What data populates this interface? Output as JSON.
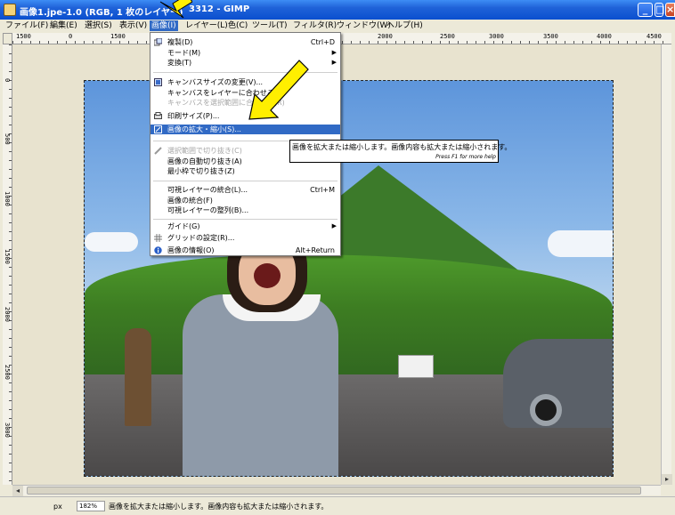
{
  "window": {
    "title_left": "画像1.jpe-1.0 (RGB, 1 枚のレイヤー)",
    "title_right": "3312 - GIMP"
  },
  "menubar": {
    "items": [
      "ファイル(F)",
      "編集(E)",
      "選択(S)",
      "表示(V)",
      "画像(I)",
      "レイヤー(L)",
      "色(C)",
      "ツール(T)",
      "フィルタ(R)",
      "ウィンドウ(W)",
      "ヘルプ(H)"
    ],
    "active_index": 4
  },
  "rulers": {
    "h_labels": [
      "1500",
      "0",
      "1500",
      "2000",
      "2500",
      "3000",
      "3500",
      "4000",
      "4500"
    ],
    "v_labels": [
      "0",
      "500",
      "1000",
      "1500",
      "2000",
      "2500",
      "3000"
    ]
  },
  "image_menu": {
    "items": [
      {
        "label": "複製(D)",
        "shortcut": "Ctrl+D",
        "icon": "duplicate-icon"
      },
      {
        "label": "モード(M)",
        "submenu": true
      },
      {
        "label": "変換(T)",
        "submenu": true
      },
      {
        "label": "キャンバスサイズの変更(V)...",
        "icon": "canvas-size-icon"
      },
      {
        "label": "キャンバスをレイヤーに合わせる(L)"
      },
      {
        "label": "キャンバスを選択範囲に合わせる(R)",
        "disabled": true
      },
      {
        "label": "印刷サイズ(P)...",
        "icon": "print-size-icon"
      },
      {
        "label": "画像の拡大・縮小(S)...",
        "highlight": true,
        "icon": "scale-image-icon"
      },
      {
        "label": "選択範囲で切り抜き(C)",
        "disabled": true,
        "icon": "crop-icon"
      },
      {
        "label": "画像の自動切り抜き(A)"
      },
      {
        "label": "最小枠で切り抜き(Z)"
      },
      {
        "label": "可視レイヤーの統合(L)...",
        "shortcut": "Ctrl+M"
      },
      {
        "label": "画像の統合(F)"
      },
      {
        "label": "可視レイヤーの整列(B)..."
      },
      {
        "label": "ガイド(G)",
        "submenu": true
      },
      {
        "label": "グリッドの設定(R)...",
        "icon": "grid-icon"
      },
      {
        "label": "画像の情報(O)",
        "shortcut": "Alt+Return",
        "icon": "info-icon"
      }
    ]
  },
  "tooltip": {
    "text": "画像を拡大または縮小します。画像内容も拡大または縮小されます。",
    "hint": "Press F1 for more help"
  },
  "statusbar": {
    "unit": "px",
    "zoom": "182%",
    "message": "画像を拡大または縮小します。画像内容も拡大または縮小されます。"
  },
  "colors": {
    "menu_highlight": "#316ac5",
    "arrow": "#ffef00",
    "titlebar": "#0a4fcf"
  }
}
